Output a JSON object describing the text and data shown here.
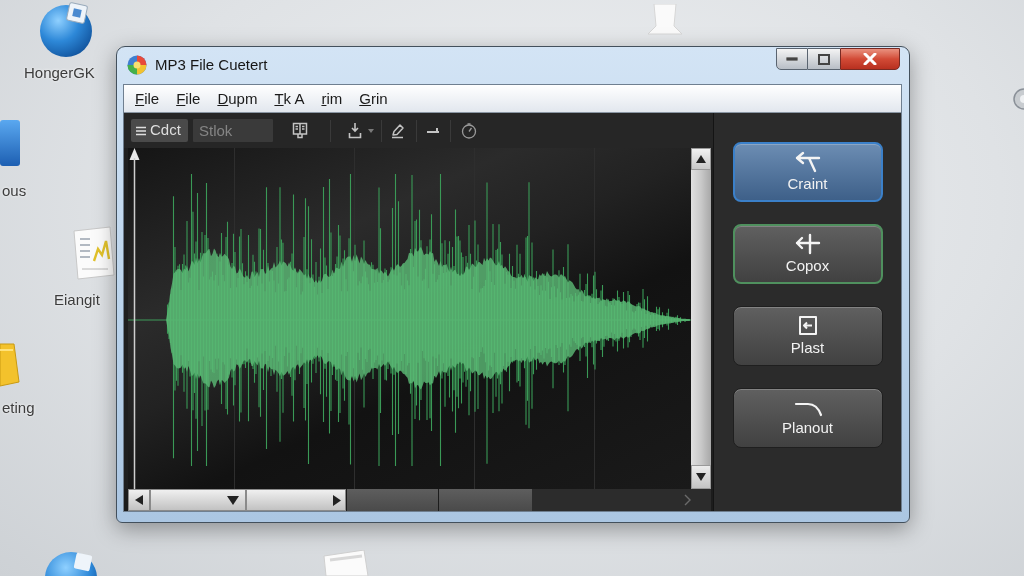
{
  "desktop": {
    "icons": [
      {
        "kind": "globe",
        "label": "HongerGK"
      },
      {
        "kind": "tile",
        "label": "ous"
      },
      {
        "kind": "document",
        "label": "Eiangit"
      },
      {
        "kind": "folder",
        "label": "eting"
      }
    ]
  },
  "window": {
    "title": "MP3 File Cuetert",
    "menu": [
      "File",
      "File",
      "Dupm",
      "Tk A",
      "rim",
      "Grin"
    ],
    "toolbar": {
      "button": "Cdct",
      "search": {
        "placeholder": "Stlok"
      }
    },
    "actions": [
      {
        "label": "Craint",
        "selected": true,
        "focused": false
      },
      {
        "label": "Copox",
        "selected": false,
        "focused": true
      },
      {
        "label": "Plast",
        "selected": false,
        "focused": false
      },
      {
        "label": "Planout",
        "selected": false,
        "focused": false
      }
    ]
  }
}
